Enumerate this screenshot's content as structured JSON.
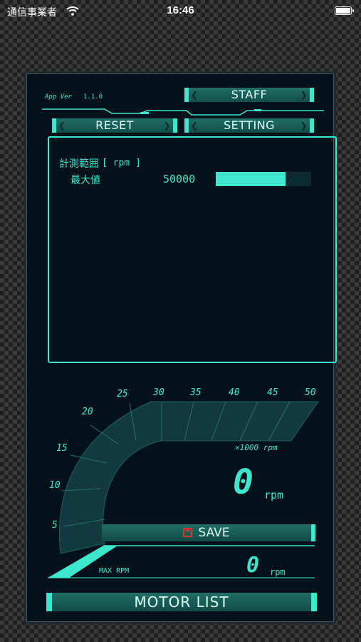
{
  "status_bar": {
    "carrier": "通信事業者",
    "time": "16:46"
  },
  "app": {
    "version_label": "App Ver",
    "version": "1.1.0",
    "buttons": {
      "staff": "STAFF",
      "reset": "RESET",
      "setting": "SETTING",
      "save": "SAVE",
      "motor_list": "MOTOR LIST"
    },
    "measurement": {
      "range_label": "計測範囲",
      "unit_bracket": "[ rpm ]",
      "max_label": "最大値",
      "max_value": "50000",
      "bar_fraction": 0.73
    },
    "gauge": {
      "ticks": [
        "5",
        "10",
        "15",
        "20",
        "25",
        "30",
        "35",
        "40",
        "45",
        "50"
      ],
      "unit_note": "×1000 rpm",
      "current_value": "0",
      "current_unit": "rpm",
      "max_rpm_label": "MAX RPM",
      "max_value": "0",
      "max_unit": "rpm"
    }
  },
  "colors": {
    "accent": "#3ee6cc",
    "panel": "#03121a",
    "button": "#1f6e66",
    "save_icon": "#e0302a"
  }
}
